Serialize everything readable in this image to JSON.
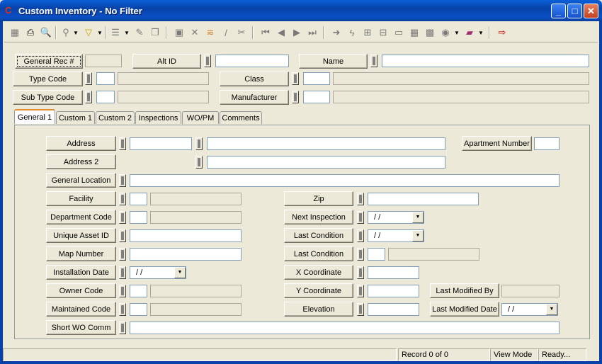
{
  "window": {
    "title": "Custom Inventory - No Filter",
    "app_icon": "C"
  },
  "toolbar": {
    "icons": [
      "grid-icon",
      "print-icon",
      "print-preview-icon",
      "query-icon",
      "filter-icon",
      "document-icon",
      "edit-record-icon",
      "copy-icon",
      "save-icon",
      "delete-icon",
      "stack-icon",
      "pen-icon",
      "cut-icon",
      "first-record-icon",
      "previous-record-icon",
      "next-record-icon",
      "last-record-icon",
      "go-icon",
      "lightning-icon",
      "tree-icon",
      "hierarchy-icon",
      "form-icon",
      "calendar-icon",
      "map-icon",
      "search-globe-icon",
      "book-icon",
      "exit-icon"
    ]
  },
  "header": {
    "general_rec_label": "General Rec #",
    "general_rec_value": "",
    "alt_id_label": "Alt ID",
    "alt_id_value": "",
    "name_label": "Name",
    "name_value": "",
    "type_code_label": "Type Code",
    "class_label": "Class",
    "sub_type_code_label": "Sub Type Code",
    "manufacturer_label": "Manufacturer"
  },
  "tabs": [
    "General 1",
    "Custom 1",
    "Custom 2",
    "Inspections",
    "WO/PM",
    "Comments"
  ],
  "form": {
    "address": "Address",
    "address2": "Address 2",
    "apartment_number": "Apartment Number",
    "general_location": "General Location",
    "facility": "Facility",
    "department_code": "Department Code",
    "unique_asset_id": "Unique Asset ID",
    "map_number": "Map Number",
    "installation_date": "Installation Date",
    "owner_code": "Owner Code",
    "maintained_code": "Maintained Code",
    "short_wo_comm": "Short WO Comm",
    "zip": "Zip",
    "next_inspection": "Next Inspection",
    "last_condition": "Last Condition",
    "last_condition2": "Last Condition",
    "x_coordinate": "X Coordinate",
    "y_coordinate": "Y Coordinate",
    "elevation": "Elevation",
    "last_modified_by": "Last Modified By",
    "last_modified_date": "Last Modified Date",
    "date_placeholder": " /  /"
  },
  "status": {
    "record": "Record 0 of 0",
    "mode": "View Mode",
    "state": "Ready..."
  }
}
